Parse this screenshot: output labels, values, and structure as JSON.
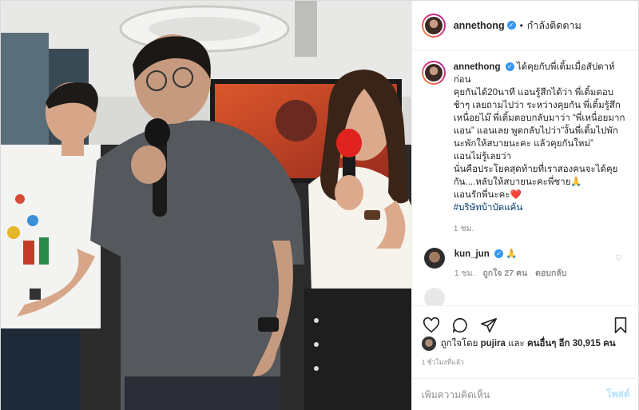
{
  "header": {
    "username": "annethong",
    "dot": "•",
    "follow_status": "กำลังติดตาม"
  },
  "caption": {
    "username": "annethong",
    "text_lines": [
      "ได้คุยกับพี่เติ้มเมื่อสัปดาห์ก่อน",
      "คุยกันได้20นาที แอนรู้สึกได้ว่า พี่เติ้มตอบช้าๆ เลยถามไปว่า ระหว่างคุยกัน พี่เติ้มรู้สึกเหนื่อยไม๊ พี่เติ้มตอบกลับมาว่า “พี่เหนื่อยมากแอน” แอนเลย พูดกลับไปว่า”งั้นพี่เติ้มไปพักนะพักให้สบายนะคะ แล้วคุยกันใหม่”",
      "แอนไม่รู้เลยว่า",
      "นั่นคือประโยคสุดท้ายที่เราสองคนจะได้คุยกัน....หลับให้สบายนะคะพี่ชาย🙏",
      "แอนรักพี่นะคะ❤️"
    ],
    "hashtag": "#บริษัทบ้าบัดแค้น",
    "time": "1 ชม."
  },
  "comment": {
    "username": "kun_jun",
    "text": "🙏",
    "time": "1 ชม.",
    "likes": "ถูกใจ 27 คน",
    "reply": "ตอบกลับ"
  },
  "likes": {
    "prefix": "ถูกใจโดย",
    "user": "pujira",
    "and": "และ",
    "others": "คนอื่นๆ อีก 30,915 คน"
  },
  "timestamp": "1 ชั่วโมงที่แล้ว",
  "add_comment": {
    "placeholder": "เพิ่มความคิดเห็น",
    "post_label": "โพสต์"
  },
  "icons": {
    "like": "heart-icon",
    "comment": "comment-icon",
    "share": "share-icon",
    "save": "bookmark-icon",
    "verified": "verified-badge-icon"
  },
  "colors": {
    "verified": "#3897f0",
    "hashtag": "#00376b",
    "muted": "#8e8e8e",
    "post_disabled": "#b2dffc",
    "mic_red": "#e0231e"
  }
}
